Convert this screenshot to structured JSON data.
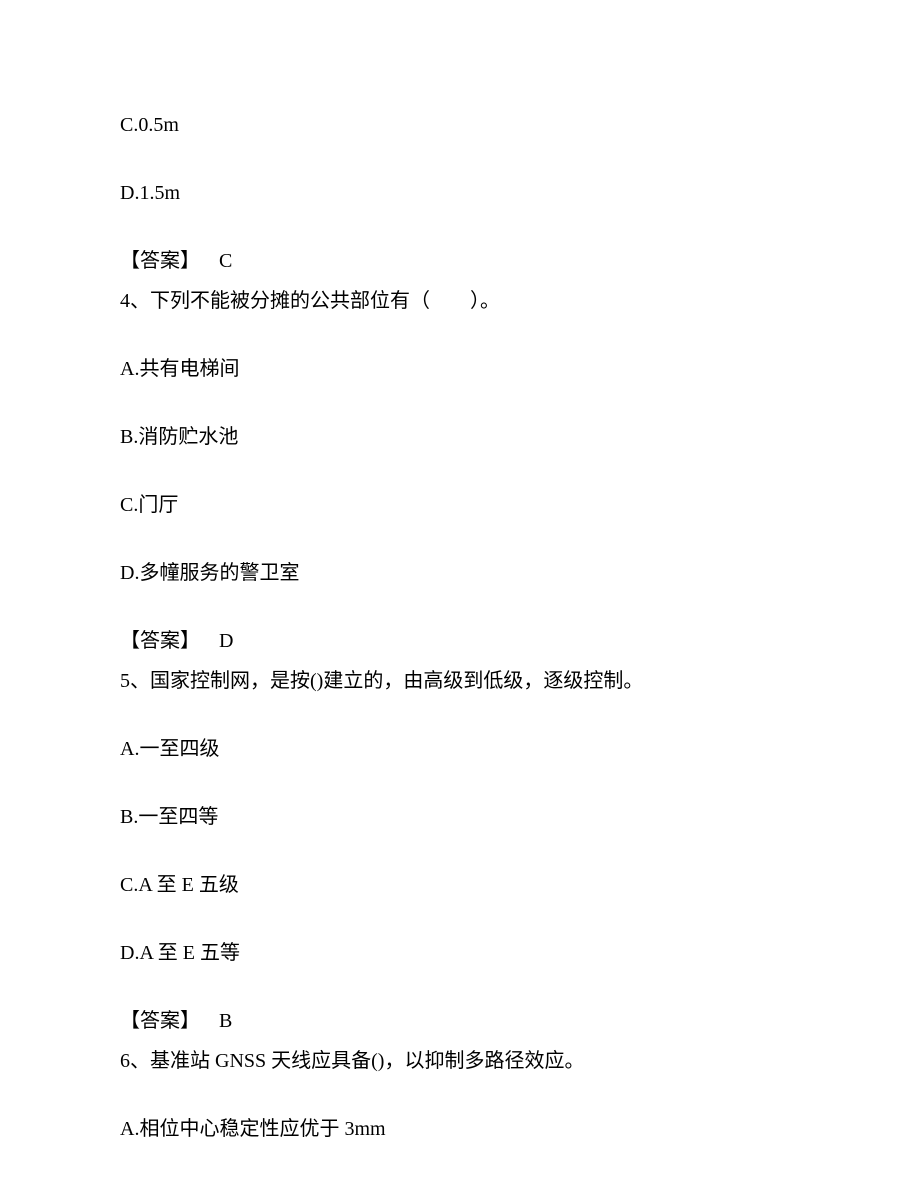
{
  "prev_options": {
    "C": "C.0.5m",
    "D": "D.1.5m"
  },
  "prev_answer": {
    "label": "【答案】",
    "letter": "C"
  },
  "q4": {
    "num": "4、",
    "text": "下列不能被分摊的公共部位有（　　）。",
    "options": {
      "A": "A.共有电梯间",
      "B": "B.消防贮水池",
      "C": "C.门厅",
      "D": "D.多幢服务的警卫室"
    },
    "answer": {
      "label": "【答案】",
      "letter": "D"
    }
  },
  "q5": {
    "num": "5、",
    "text": "国家控制网，是按()建立的，由高级到低级，逐级控制。",
    "options": {
      "A": "A.一至四级",
      "B": "B.一至四等",
      "C": "C.A 至 E 五级",
      "D": "D.A 至 E 五等"
    },
    "answer": {
      "label": "【答案】",
      "letter": "B"
    }
  },
  "q6": {
    "num": "6、",
    "text": "基准站 GNSS 天线应具备()，以抑制多路径效应。",
    "options": {
      "A": "A.相位中心稳定性应优于 3mm"
    }
  }
}
